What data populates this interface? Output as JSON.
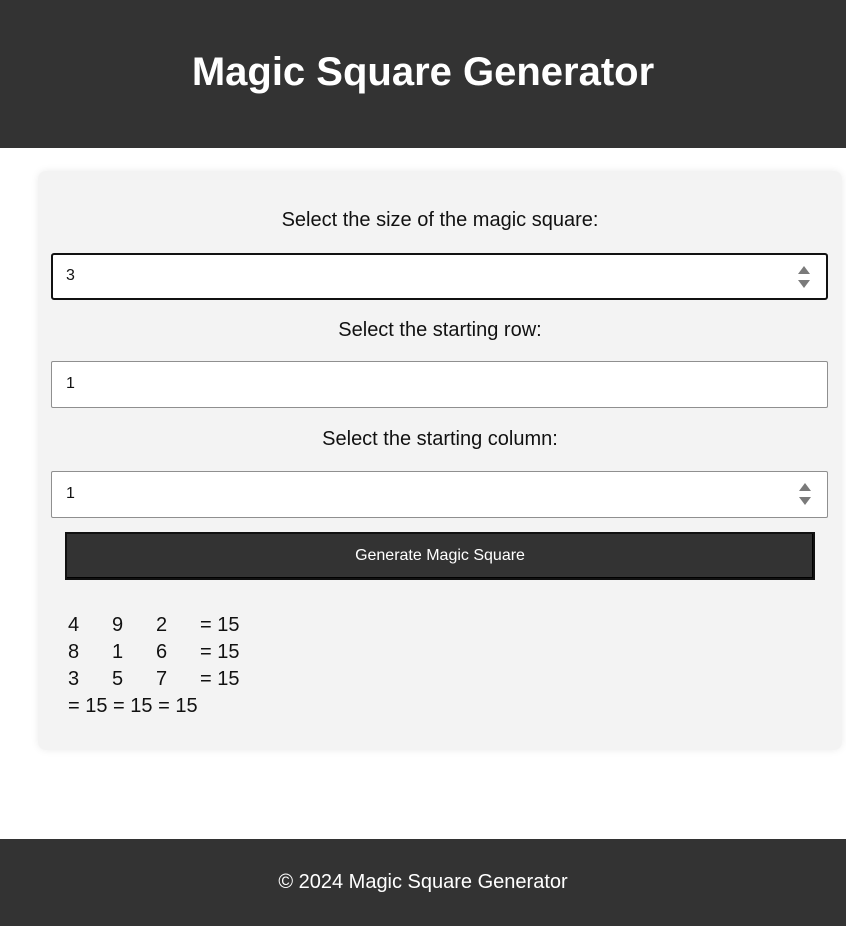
{
  "header": {
    "title": "Magic Square Generator"
  },
  "form": {
    "size_label": "Select the size of the magic square:",
    "size_value": "3",
    "row_label": "Select the starting row:",
    "row_value": "1",
    "col_label": "Select the starting column:",
    "col_value": "1",
    "generate_label": "Generate Magic Square"
  },
  "result": {
    "rows": [
      {
        "cells": [
          "4",
          "9",
          "2"
        ],
        "sum": "= 15"
      },
      {
        "cells": [
          "8",
          "1",
          "6"
        ],
        "sum": "= 15"
      },
      {
        "cells": [
          "3",
          "5",
          "7"
        ],
        "sum": "= 15"
      }
    ],
    "column_sums": "= 15 = 15 = 15"
  },
  "footer": {
    "text": "© 2024 Magic Square Generator"
  },
  "colors": {
    "bar": "#333333",
    "panel": "#f3f3f3",
    "page": "#ffffff"
  },
  "icons": {
    "size_spinner": "spinner-arrows-icon",
    "col_spinner": "spinner-arrows-icon"
  }
}
